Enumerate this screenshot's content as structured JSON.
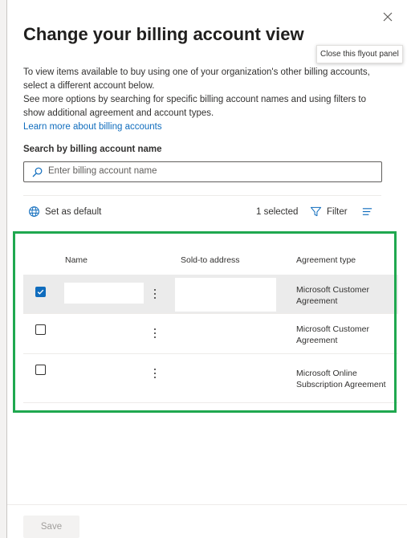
{
  "panel": {
    "title": "Change your billing account view",
    "close_tooltip": "Close this flyout panel",
    "description": {
      "line1": "To view items available to buy using one of your organization's other billing accounts, select a different account below.",
      "line2": "See more options by searching for specific billing account names and using filters to show additional agreement and account types.",
      "link": "Learn more about billing accounts"
    }
  },
  "search": {
    "label": "Search by billing account name",
    "placeholder": "Enter billing account name",
    "value": ""
  },
  "toolbar": {
    "set_default": "Set as default",
    "selected_count": "1 selected",
    "filter": "Filter"
  },
  "table": {
    "columns": [
      "Name",
      "Sold-to address",
      "Agreement type"
    ],
    "rows": [
      {
        "selected": true,
        "agreement": "Microsoft Customer Agreement"
      },
      {
        "selected": false,
        "agreement": "Microsoft Customer Agreement"
      },
      {
        "selected": false,
        "agreement": "Microsoft Online Subscription Agreement"
      }
    ]
  },
  "footer": {
    "save_label": "Save"
  },
  "colors": {
    "accent": "#0f6cbd",
    "highlight": "#1fa84f",
    "selected_row": "#ebebeb"
  },
  "icons": [
    "close-icon",
    "search-icon",
    "globe-icon",
    "filter-icon",
    "list-menu-icon",
    "more-vertical-icon",
    "checkmark-icon"
  ]
}
